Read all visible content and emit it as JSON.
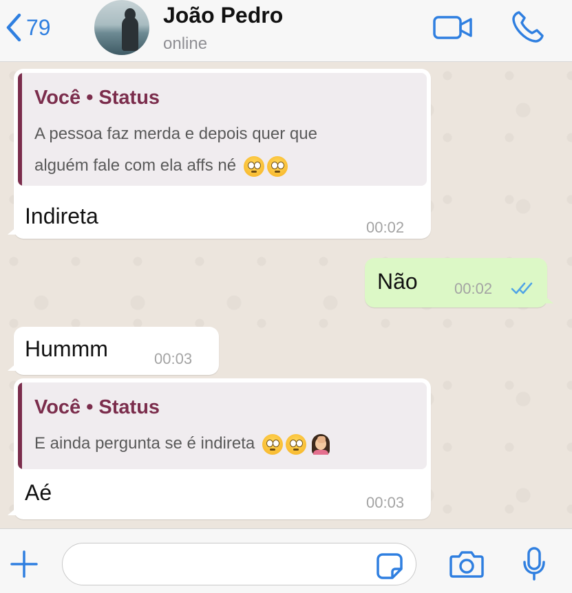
{
  "header": {
    "back_count": "79",
    "contact_name": "João Pedro",
    "contact_status": "online"
  },
  "messages": [
    {
      "direction": "in",
      "quote_title": "Você • Status",
      "quote_text_line1": "A pessoa faz merda e depois quer que",
      "quote_text_line2": "alguém fale com ela affs né",
      "quote_emojis": [
        "face-with-rolling-eyes",
        "face-with-rolling-eyes"
      ],
      "text": "Indireta",
      "time": "00:02"
    },
    {
      "direction": "out",
      "text": "Não",
      "time": "00:02",
      "read_status": "read-double-check"
    },
    {
      "direction": "in",
      "text": "Hummm",
      "time": "00:03"
    },
    {
      "direction": "in",
      "quote_title": "Você • Status",
      "quote_text_line1": "E ainda pergunta se é indireta",
      "quote_emojis": [
        "face-with-rolling-eyes",
        "face-with-rolling-eyes",
        "woman-facepalming"
      ],
      "text": "Aé",
      "time": "00:03"
    }
  ],
  "input": {
    "value": "",
    "placeholder": ""
  },
  "colors": {
    "accent": "#2f7fe0",
    "quote_author": "#7b2d4c",
    "outgoing_bubble": "#dcf8c6",
    "chat_background": "#ece5dd"
  },
  "icons": [
    "chevron-left-icon",
    "video-camera-icon",
    "phone-icon",
    "plus-icon",
    "sticker-icon",
    "camera-icon",
    "microphone-icon",
    "double-check-icon"
  ]
}
